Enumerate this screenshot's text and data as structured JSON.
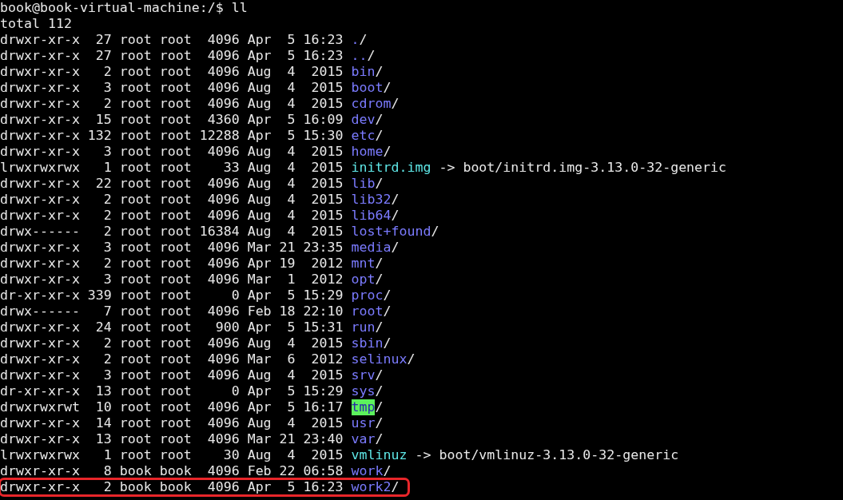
{
  "prompt": "book@book-virtual-machine:/$ ll",
  "total": "total 112",
  "entries": [
    {
      "kind": "dir",
      "perms": "drwxr-xr-x",
      "links": "27",
      "owner": "root",
      "group": "root",
      "size": "4096",
      "month": "Apr",
      "day": "5",
      "time": "16:23",
      "name": ".",
      "suffix": "/",
      "highlighted": false
    },
    {
      "kind": "dir",
      "perms": "drwxr-xr-x",
      "links": "27",
      "owner": "root",
      "group": "root",
      "size": "4096",
      "month": "Apr",
      "day": "5",
      "time": "16:23",
      "name": "..",
      "suffix": "/",
      "highlighted": false
    },
    {
      "kind": "dir",
      "perms": "drwxr-xr-x",
      "links": "2",
      "owner": "root",
      "group": "root",
      "size": "4096",
      "month": "Aug",
      "day": "4",
      "time": "2015",
      "name": "bin",
      "suffix": "/",
      "highlighted": false
    },
    {
      "kind": "dir",
      "perms": "drwxr-xr-x",
      "links": "3",
      "owner": "root",
      "group": "root",
      "size": "4096",
      "month": "Aug",
      "day": "4",
      "time": "2015",
      "name": "boot",
      "suffix": "/",
      "highlighted": false
    },
    {
      "kind": "dir",
      "perms": "drwxr-xr-x",
      "links": "2",
      "owner": "root",
      "group": "root",
      "size": "4096",
      "month": "Aug",
      "day": "4",
      "time": "2015",
      "name": "cdrom",
      "suffix": "/",
      "highlighted": false
    },
    {
      "kind": "dir",
      "perms": "drwxr-xr-x",
      "links": "15",
      "owner": "root",
      "group": "root",
      "size": "4360",
      "month": "Apr",
      "day": "5",
      "time": "16:09",
      "name": "dev",
      "suffix": "/",
      "highlighted": false
    },
    {
      "kind": "dir",
      "perms": "drwxr-xr-x",
      "links": "132",
      "owner": "root",
      "group": "root",
      "size": "12288",
      "month": "Apr",
      "day": "5",
      "time": "15:30",
      "name": "etc",
      "suffix": "/",
      "highlighted": false
    },
    {
      "kind": "dir",
      "perms": "drwxr-xr-x",
      "links": "3",
      "owner": "root",
      "group": "root",
      "size": "4096",
      "month": "Aug",
      "day": "4",
      "time": "2015",
      "name": "home",
      "suffix": "/",
      "highlighted": false
    },
    {
      "kind": "link",
      "perms": "lrwxrwxrwx",
      "links": "1",
      "owner": "root",
      "group": "root",
      "size": "33",
      "month": "Aug",
      "day": "4",
      "time": "2015",
      "name": "initrd.img",
      "arrow": "->",
      "target": "boot/initrd.img-3.13.0-32-generic",
      "highlighted": false
    },
    {
      "kind": "dir",
      "perms": "drwxr-xr-x",
      "links": "22",
      "owner": "root",
      "group": "root",
      "size": "4096",
      "month": "Aug",
      "day": "4",
      "time": "2015",
      "name": "lib",
      "suffix": "/",
      "highlighted": false
    },
    {
      "kind": "dir",
      "perms": "drwxr-xr-x",
      "links": "2",
      "owner": "root",
      "group": "root",
      "size": "4096",
      "month": "Aug",
      "day": "4",
      "time": "2015",
      "name": "lib32",
      "suffix": "/",
      "highlighted": false
    },
    {
      "kind": "dir",
      "perms": "drwxr-xr-x",
      "links": "2",
      "owner": "root",
      "group": "root",
      "size": "4096",
      "month": "Aug",
      "day": "4",
      "time": "2015",
      "name": "lib64",
      "suffix": "/",
      "highlighted": false
    },
    {
      "kind": "dir",
      "perms": "drwx------",
      "links": "2",
      "owner": "root",
      "group": "root",
      "size": "16384",
      "month": "Aug",
      "day": "4",
      "time": "2015",
      "name": "lost+found",
      "suffix": "/",
      "highlighted": false
    },
    {
      "kind": "dir",
      "perms": "drwxr-xr-x",
      "links": "3",
      "owner": "root",
      "group": "root",
      "size": "4096",
      "month": "Mar",
      "day": "21",
      "time": "23:35",
      "name": "media",
      "suffix": "/",
      "highlighted": false
    },
    {
      "kind": "dir",
      "perms": "drwxr-xr-x",
      "links": "2",
      "owner": "root",
      "group": "root",
      "size": "4096",
      "month": "Apr",
      "day": "19",
      "time": "2012",
      "name": "mnt",
      "suffix": "/",
      "highlighted": false
    },
    {
      "kind": "dir",
      "perms": "drwxr-xr-x",
      "links": "3",
      "owner": "root",
      "group": "root",
      "size": "4096",
      "month": "Mar",
      "day": "1",
      "time": "2012",
      "name": "opt",
      "suffix": "/",
      "highlighted": false
    },
    {
      "kind": "dir",
      "perms": "dr-xr-xr-x",
      "links": "339",
      "owner": "root",
      "group": "root",
      "size": "0",
      "month": "Apr",
      "day": "5",
      "time": "15:29",
      "name": "proc",
      "suffix": "/",
      "highlighted": false
    },
    {
      "kind": "dir",
      "perms": "drwx------",
      "links": "7",
      "owner": "root",
      "group": "root",
      "size": "4096",
      "month": "Feb",
      "day": "18",
      "time": "22:10",
      "name": "root",
      "suffix": "/",
      "highlighted": false
    },
    {
      "kind": "dir",
      "perms": "drwxr-xr-x",
      "links": "24",
      "owner": "root",
      "group": "root",
      "size": "900",
      "month": "Apr",
      "day": "5",
      "time": "15:31",
      "name": "run",
      "suffix": "/",
      "highlighted": false
    },
    {
      "kind": "dir",
      "perms": "drwxr-xr-x",
      "links": "2",
      "owner": "root",
      "group": "root",
      "size": "4096",
      "month": "Aug",
      "day": "4",
      "time": "2015",
      "name": "sbin",
      "suffix": "/",
      "highlighted": false
    },
    {
      "kind": "dir",
      "perms": "drwxr-xr-x",
      "links": "2",
      "owner": "root",
      "group": "root",
      "size": "4096",
      "month": "Mar",
      "day": "6",
      "time": "2012",
      "name": "selinux",
      "suffix": "/",
      "highlighted": false
    },
    {
      "kind": "dir",
      "perms": "drwxr-xr-x",
      "links": "3",
      "owner": "root",
      "group": "root",
      "size": "4096",
      "month": "Aug",
      "day": "4",
      "time": "2015",
      "name": "srv",
      "suffix": "/",
      "highlighted": false
    },
    {
      "kind": "dir",
      "perms": "dr-xr-xr-x",
      "links": "13",
      "owner": "root",
      "group": "root",
      "size": "0",
      "month": "Apr",
      "day": "5",
      "time": "15:29",
      "name": "sys",
      "suffix": "/",
      "highlighted": false
    },
    {
      "kind": "sticky",
      "perms": "drwxrwxrwt",
      "links": "10",
      "owner": "root",
      "group": "root",
      "size": "4096",
      "month": "Apr",
      "day": "5",
      "time": "16:17",
      "name": "tmp",
      "suffix": "/",
      "highlighted": false
    },
    {
      "kind": "dir",
      "perms": "drwxr-xr-x",
      "links": "14",
      "owner": "root",
      "group": "root",
      "size": "4096",
      "month": "Aug",
      "day": "4",
      "time": "2015",
      "name": "usr",
      "suffix": "/",
      "highlighted": false
    },
    {
      "kind": "dir",
      "perms": "drwxr-xr-x",
      "links": "13",
      "owner": "root",
      "group": "root",
      "size": "4096",
      "month": "Mar",
      "day": "21",
      "time": "23:40",
      "name": "var",
      "suffix": "/",
      "highlighted": false
    },
    {
      "kind": "link",
      "perms": "lrwxrwxrwx",
      "links": "1",
      "owner": "root",
      "group": "root",
      "size": "30",
      "month": "Aug",
      "day": "4",
      "time": "2015",
      "name": "vmlinuz",
      "arrow": "->",
      "target": "boot/vmlinuz-3.13.0-32-generic",
      "highlighted": false
    },
    {
      "kind": "dir",
      "perms": "drwxr-xr-x",
      "links": "8",
      "owner": "book",
      "group": "book",
      "size": "4096",
      "month": "Feb",
      "day": "22",
      "time": "06:58",
      "name": "work",
      "suffix": "/",
      "highlighted": false
    },
    {
      "kind": "dir",
      "perms": "drwxr-xr-x",
      "links": "2",
      "owner": "book",
      "group": "book",
      "size": "4096",
      "month": "Apr",
      "day": "5",
      "time": "16:23",
      "name": "work2",
      "suffix": "/",
      "highlighted": true
    }
  ]
}
